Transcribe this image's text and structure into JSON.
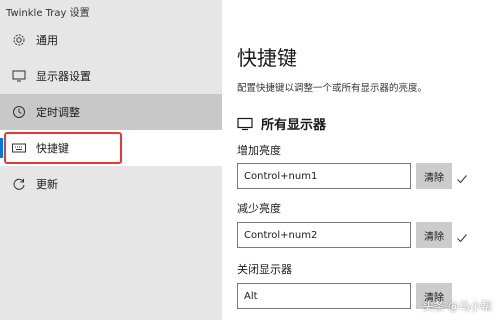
{
  "app": {
    "title": "Twinkle Tray 设置"
  },
  "sidebar": {
    "items": [
      {
        "label": "通用",
        "icon": "gear-icon"
      },
      {
        "label": "显示器设置",
        "icon": "monitor-icon"
      },
      {
        "label": "定时调整",
        "icon": "clock-icon"
      },
      {
        "label": "快捷键",
        "icon": "keyboard-icon"
      },
      {
        "label": "更新",
        "icon": "refresh-icon"
      }
    ]
  },
  "main": {
    "title": "快捷键",
    "description": "配置快捷键以调整一个或所有显示器的亮度。",
    "section_title": "所有显示器",
    "fields": [
      {
        "label": "增加亮度",
        "value": "Control+num1",
        "clear_label": "清除"
      },
      {
        "label": "减少亮度",
        "value": "Control+num2",
        "clear_label": "清除"
      },
      {
        "label": "关闭显示器",
        "value": "Alt",
        "clear_label": "清除"
      }
    ]
  },
  "watermark": {
    "text": "头条 @马小帮"
  },
  "colors": {
    "sidebar_bg": "#e6e6e6",
    "hover_bg": "#c8c8c8",
    "highlight": "#e53935",
    "button_bg": "#cccccc"
  }
}
